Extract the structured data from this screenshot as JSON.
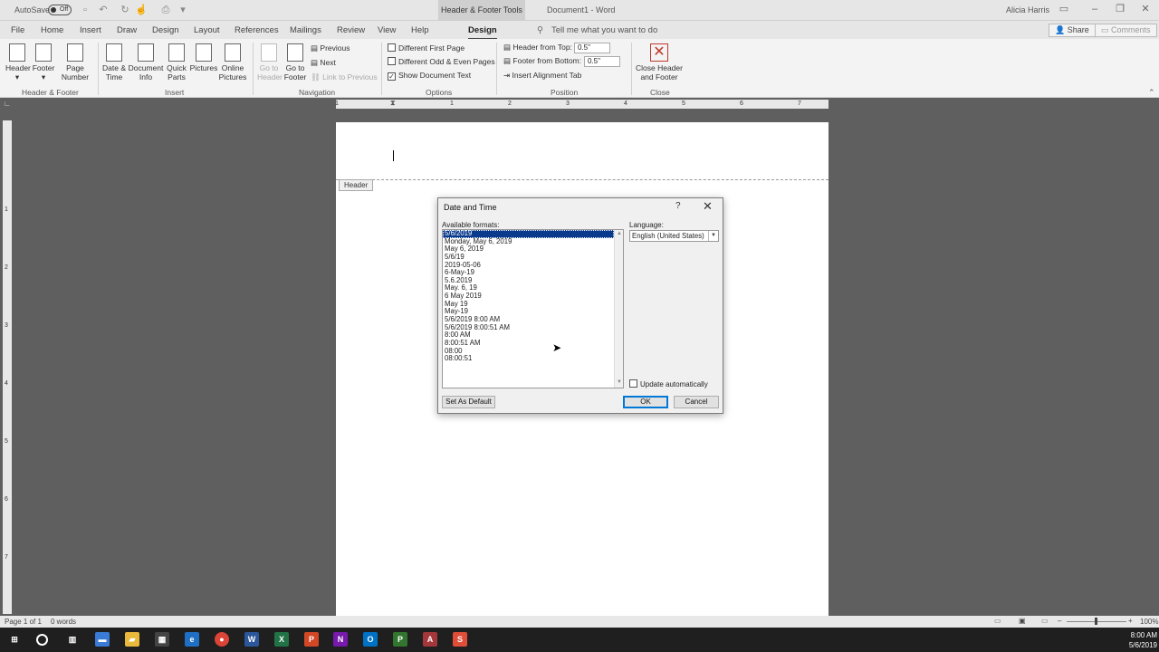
{
  "title_bar": {
    "autosave_label": "AutoSave",
    "autosave_state": "Off",
    "context_tab": "Header & Footer Tools",
    "doc_title": "Document1  -  Word",
    "user": "Alicia Harris"
  },
  "tabs": [
    "File",
    "Home",
    "Insert",
    "Draw",
    "Design",
    "Layout",
    "References",
    "Mailings",
    "Review",
    "View",
    "Help",
    "Design"
  ],
  "tell_me": "Tell me what you want to do",
  "share_label": "Share",
  "comments_label": "Comments",
  "ribbon": {
    "hf": {
      "header": "Header",
      "footer": "Footer",
      "page_number_1": "Page",
      "page_number_2": "Number",
      "group": "Header & Footer"
    },
    "insert": {
      "date_1": "Date &",
      "date_2": "Time",
      "docinfo_1": "Document",
      "docinfo_2": "Info",
      "quick_1": "Quick",
      "quick_2": "Parts",
      "pictures": "Pictures",
      "online_1": "Online",
      "online_2": "Pictures",
      "group": "Insert"
    },
    "nav": {
      "goto_header_1": "Go to",
      "goto_header_2": "Header",
      "goto_footer_1": "Go to",
      "goto_footer_2": "Footer",
      "previous": "Previous",
      "next": "Next",
      "link": "Link to Previous",
      "group": "Navigation"
    },
    "options": {
      "diff_first": "Different First Page",
      "diff_odd": "Different Odd & Even Pages",
      "show_text": "Show Document Text",
      "group": "Options"
    },
    "position": {
      "header_top": "Header from Top:",
      "header_val": "0.5\"",
      "footer_bottom": "Footer from Bottom:",
      "footer_val": "0.5\"",
      "align_tab": "Insert Alignment Tab",
      "group": "Position"
    },
    "close": {
      "label_1": "Close Header",
      "label_2": "and Footer",
      "group": "Close"
    }
  },
  "ruler_numbers": [
    "1",
    "1",
    "2",
    "3",
    "4",
    "5",
    "6",
    "7"
  ],
  "vruler_numbers": [
    "1",
    "2",
    "3",
    "4",
    "5",
    "6",
    "7"
  ],
  "page": {
    "header_tag": "Header"
  },
  "dialog": {
    "title": "Date and Time",
    "help": "?",
    "close": "✕",
    "formats_label": "Available formats:",
    "formats": [
      "5/6/2019",
      "Monday, May 6, 2019",
      "May 6, 2019",
      "5/6/19",
      "2019-05-06",
      "6-May-19",
      "5.6.2019",
      "May. 6, 19",
      "6 May 2019",
      "May 19",
      "May-19",
      "5/6/2019 8:00 AM",
      "5/6/2019 8:00:51 AM",
      "8:00 AM",
      "8:00:51 AM",
      "08:00",
      "08:00:51"
    ],
    "selected_index": 0,
    "language_label": "Language:",
    "language_value": "English (United States)",
    "update_label": "Update automatically",
    "set_default": "Set As Default",
    "ok": "OK",
    "cancel": "Cancel"
  },
  "status": {
    "page": "Page 1 of 1",
    "words": "0 words",
    "zoom": "100%"
  },
  "clock": {
    "time": "8:00 AM",
    "date": "5/6/2019"
  }
}
